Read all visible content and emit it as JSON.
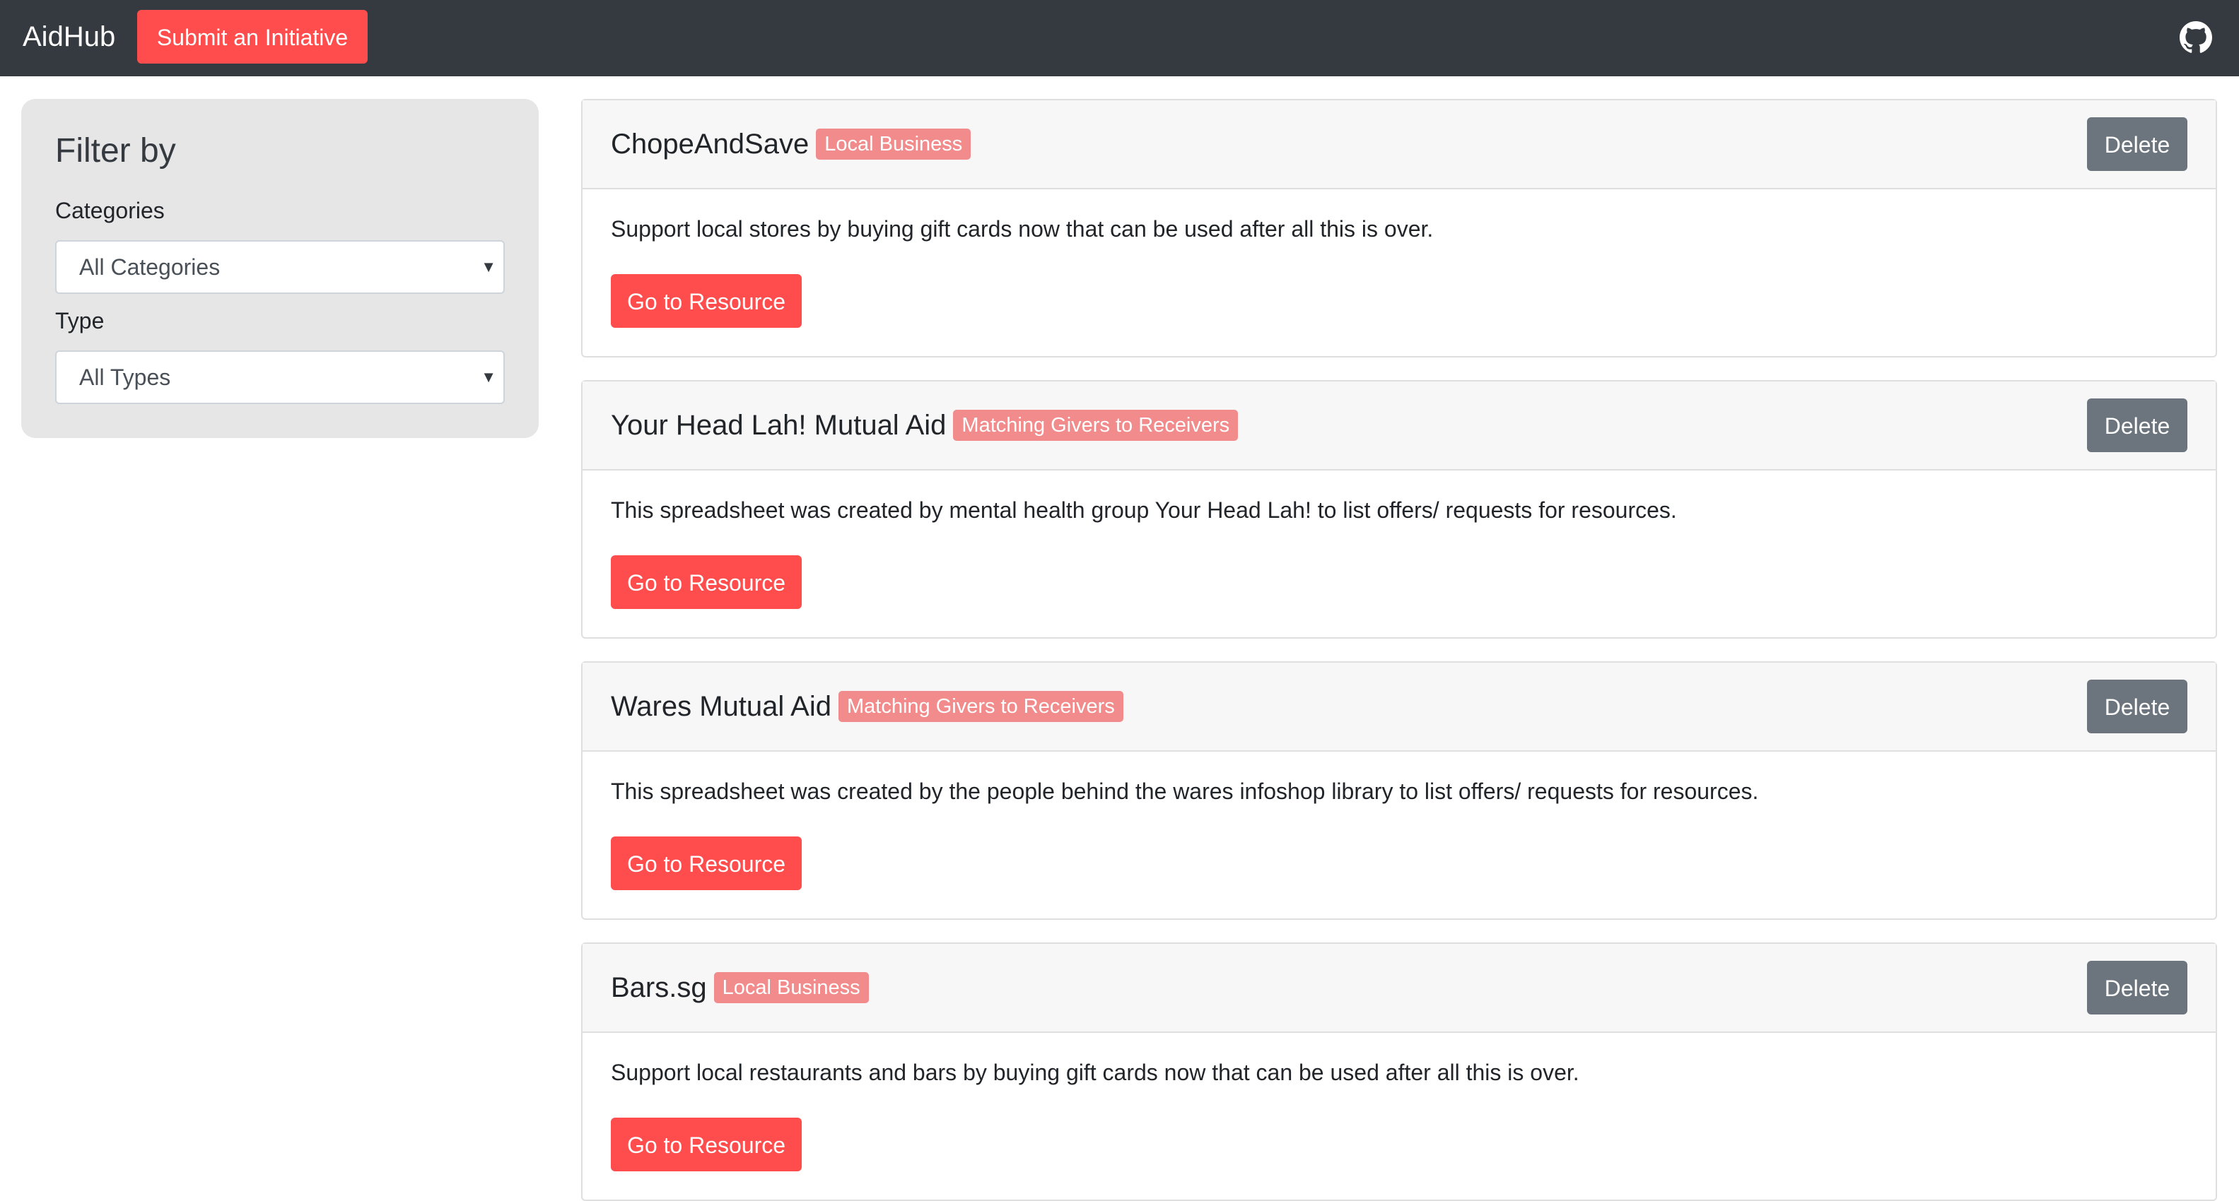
{
  "navbar": {
    "brand": "AidHub",
    "submit_label": "Submit an Initiative",
    "github_icon": "github-icon"
  },
  "sidebar": {
    "title": "Filter by",
    "categories_label": "Categories",
    "categories_value": "All Categories",
    "type_label": "Type",
    "type_value": "All Types"
  },
  "cards": [
    {
      "title": "ChopeAndSave",
      "badge": "Local Business",
      "delete_label": "Delete",
      "description": "Support local stores by buying gift cards now that can be used after all this is over.",
      "button_label": "Go to Resource"
    },
    {
      "title": "Your Head Lah! Mutual Aid",
      "badge": "Matching Givers to Receivers",
      "delete_label": "Delete",
      "description": "This spreadsheet was created by mental health group Your Head Lah! to list offers/ requests for resources.",
      "button_label": "Go to Resource"
    },
    {
      "title": "Wares Mutual Aid",
      "badge": "Matching Givers to Receivers",
      "delete_label": "Delete",
      "description": "This spreadsheet was created by the people behind the wares infoshop library to list offers/ requests for resources.",
      "button_label": "Go to Resource"
    },
    {
      "title": "Bars.sg",
      "badge": "Local Business",
      "delete_label": "Delete",
      "description": "Support local restaurants and bars by buying gift cards now that can be used after all this is over.",
      "button_label": "Go to Resource"
    }
  ],
  "colors": {
    "navbar_bg": "#343a40",
    "accent": "#ff4d4d",
    "badge_bg": "#f28b8b",
    "delete_bg": "#6c757d"
  }
}
